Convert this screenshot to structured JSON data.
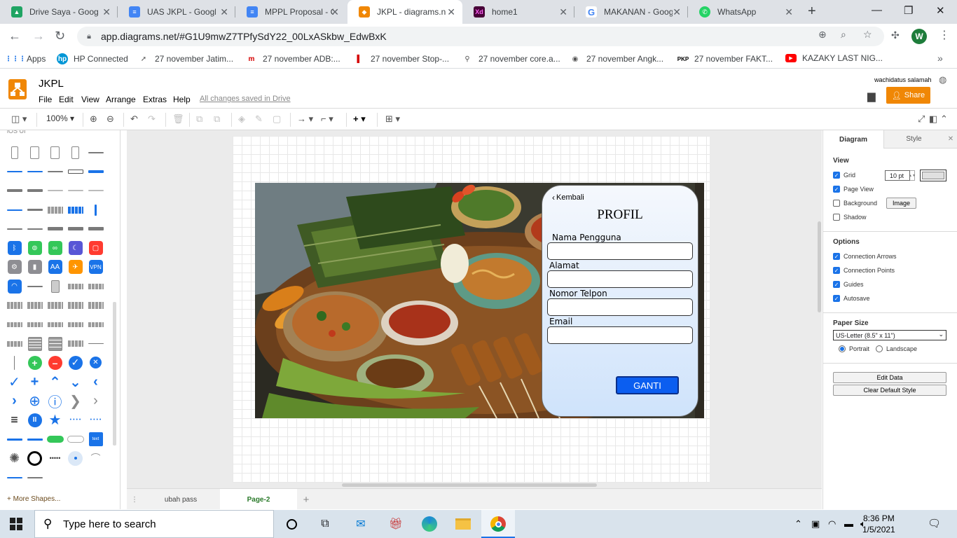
{
  "browser": {
    "tabs": [
      {
        "title": "Drive Saya - Goog",
        "icon": "google-drive-icon",
        "color": "#1fa463"
      },
      {
        "title": "UAS JKPL - Google",
        "icon": "google-docs-icon",
        "color": "#4285f4"
      },
      {
        "title": "MPPL Proposal - G",
        "icon": "google-docs-icon",
        "color": "#4285f4"
      },
      {
        "title": "JKPL - diagrams.ne",
        "icon": "drawio-icon",
        "color": "#f08705"
      },
      {
        "title": "home1",
        "icon": "adobe-xd-icon",
        "color": "#470137"
      },
      {
        "title": "MAKANAN - Goog",
        "icon": "google-icon",
        "color": "#4285f4"
      },
      {
        "title": "WhatsApp",
        "icon": "whatsapp-icon",
        "color": "#25d366"
      }
    ],
    "url": "app.diagrams.net/#G1U9mwZ7TPfySdY22_00LxASkbw_EdwBxK",
    "profile_initial": "W",
    "bookmarks": [
      {
        "label": "Apps",
        "icon": "apps-grid-icon"
      },
      {
        "label": "HP Connected",
        "icon": "hp-icon"
      },
      {
        "label": "27 november Jatim...",
        "icon": "bookmark-icon"
      },
      {
        "label": "27 november ADB:...",
        "icon": "bookmark-icon"
      },
      {
        "label": "27 november Stop-...",
        "icon": "bookmark-icon"
      },
      {
        "label": "27 november core.a...",
        "icon": "bookmark-icon"
      },
      {
        "label": "27 november Angk...",
        "icon": "bookmark-icon"
      },
      {
        "label": "27 november FAKT...",
        "icon": "pkp-icon"
      },
      {
        "label": "KAZAKY LAST NIG...",
        "icon": "youtube-icon"
      }
    ]
  },
  "drawio": {
    "file_title": "JKPL",
    "menu": [
      "File",
      "Edit",
      "View",
      "Arrange",
      "Extras",
      "Help"
    ],
    "saved_status": "All changes saved in Drive",
    "user": "wachidatus salamah",
    "share_label": "Share",
    "zoom": "100%",
    "more_shapes": "+ More Shapes...",
    "pages": [
      "ubah pass",
      "Page-2"
    ],
    "active_page": "Page-2"
  },
  "mockup": {
    "back_label": "Kembali",
    "title": "PROFIL",
    "fields": [
      {
        "label": "Nama Pengguna",
        "value": ""
      },
      {
        "label": "Alamat",
        "value": ""
      },
      {
        "label": "Nomor Telpon",
        "value": ""
      },
      {
        "label": "Email",
        "value": ""
      }
    ],
    "button_label": "GANTI"
  },
  "format_panel": {
    "tabs": [
      "Diagram",
      "Style"
    ],
    "view_heading": "View",
    "grid_label": "Grid",
    "grid_size": "10 pt",
    "page_view_label": "Page View",
    "background_label": "Background",
    "image_button": "Image",
    "shadow_label": "Shadow",
    "options_heading": "Options",
    "options": [
      "Connection Arrows",
      "Connection Points",
      "Guides",
      "Autosave"
    ],
    "paper_heading": "Paper Size",
    "paper_size": "US-Letter (8.5\" x 11\")",
    "portrait_label": "Portrait",
    "landscape_label": "Landscape",
    "edit_data": "Edit Data",
    "clear_style": "Clear Default Style"
  },
  "taskbar": {
    "search_placeholder": "Type here to search",
    "time": "8:36 PM",
    "date": "1/5/2021"
  }
}
